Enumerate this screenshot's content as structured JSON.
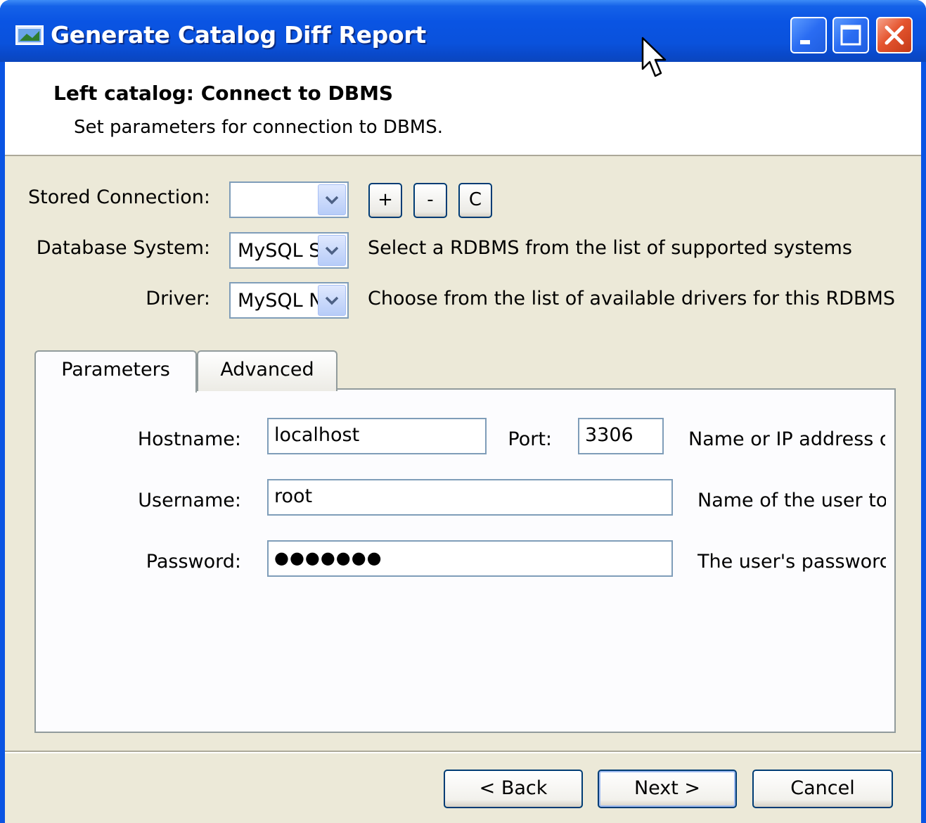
{
  "window": {
    "title": "Generate Catalog Diff Report"
  },
  "header": {
    "title": "Left catalog: Connect to DBMS",
    "subtitle": "Set parameters for connection to DBMS."
  },
  "connection": {
    "stored_label": "Stored Connection:",
    "stored_value": "",
    "add_label": "+",
    "remove_label": "-",
    "clear_label": "C",
    "dbsystem_label": "Database System:",
    "dbsystem_value": "MySQL Server",
    "dbsystem_hint": "Select a RDBMS from the list of supported systems",
    "driver_label": "Driver:",
    "driver_value": "MySQL Native Driver",
    "driver_hint": "Choose from the list of available drivers for this RDBMS"
  },
  "tabs": [
    {
      "label": "Parameters",
      "active": true
    },
    {
      "label": "Advanced",
      "active": false
    }
  ],
  "parameters": {
    "hostname_label": "Hostname:",
    "hostname_value": "localhost",
    "port_label": "Port:",
    "port_value": "3306",
    "hostname_hint": "Name or IP address of",
    "username_label": "Username:",
    "username_value": "root",
    "username_hint": "Name of the user to c",
    "password_label": "Password:",
    "password_value": "●●●●●●●",
    "password_hint": "The user's password."
  },
  "buttons": {
    "back": "< Back",
    "next": "Next >",
    "cancel": "Cancel"
  },
  "colors": {
    "titlebar": "#0a54e3",
    "client_bg": "#ece9d8",
    "close_button": "#e5552f",
    "field_border": "#7f9db9"
  }
}
